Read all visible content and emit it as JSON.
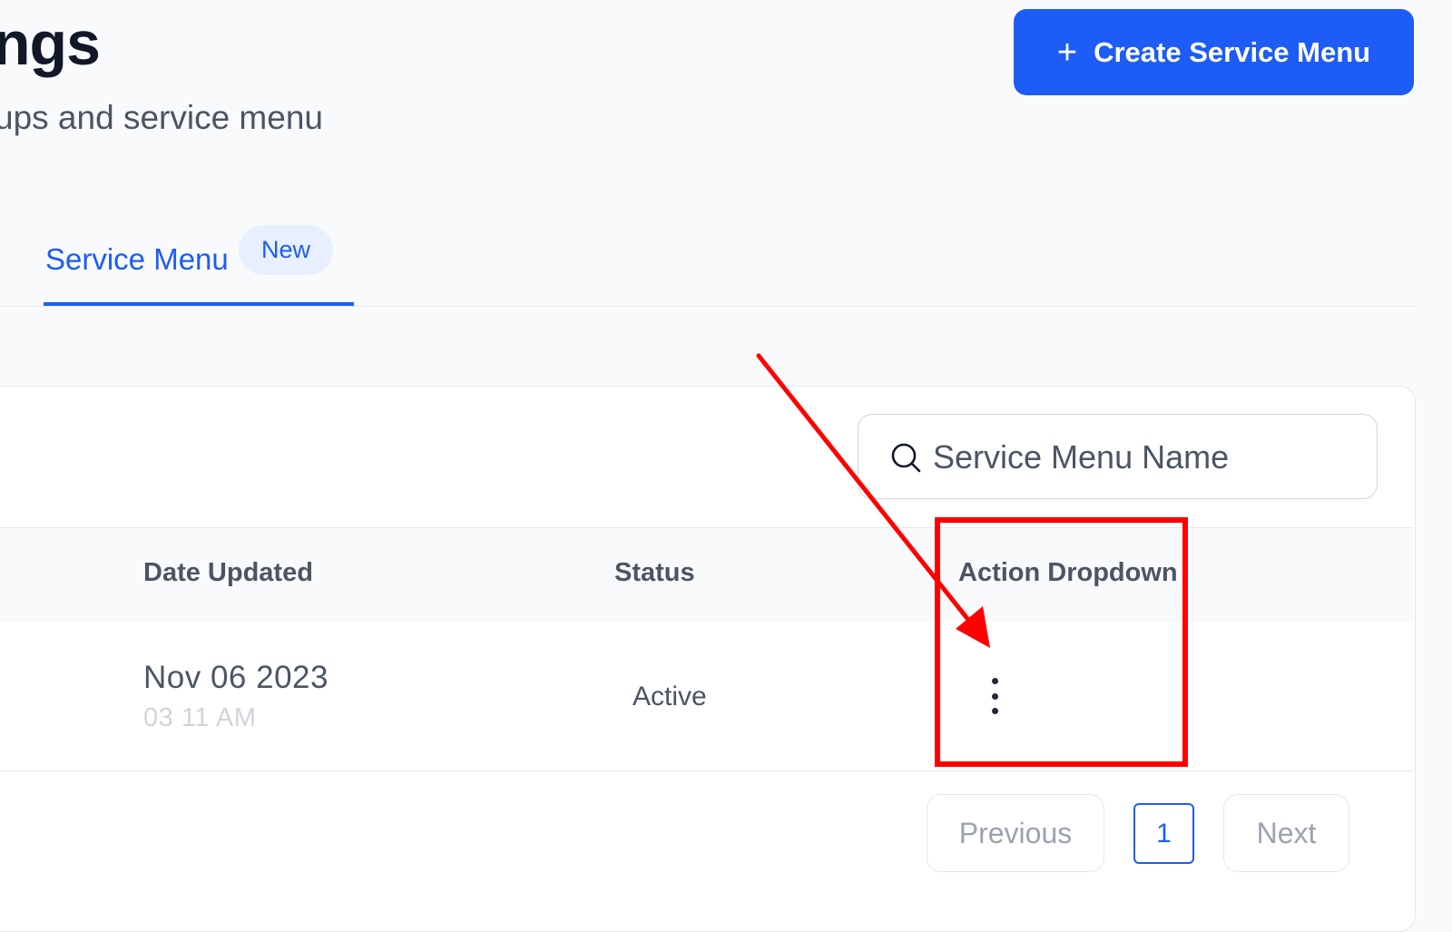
{
  "header": {
    "title": "ngs",
    "subtitle": "ups and service menu",
    "create_button_icon": "plus-icon",
    "create_button_label": "Create Service Menu"
  },
  "tabs": [
    {
      "label": "Service Menu",
      "badge": "New",
      "active": true
    }
  ],
  "search": {
    "icon": "search-icon",
    "placeholder": "Service Menu Name",
    "value": ""
  },
  "table": {
    "columns": [
      "Date Updated",
      "Status",
      "Action Dropdown"
    ],
    "rows": [
      {
        "date": "Nov 06 2023",
        "time": "03 11 AM",
        "status": "Active",
        "action_icon": "more-vertical-icon"
      }
    ]
  },
  "pagination": {
    "previous_label": "Previous",
    "current_page": "1",
    "next_label": "Next"
  },
  "colors": {
    "primary": "#1d5cf5",
    "annotation": "#ff0000"
  }
}
